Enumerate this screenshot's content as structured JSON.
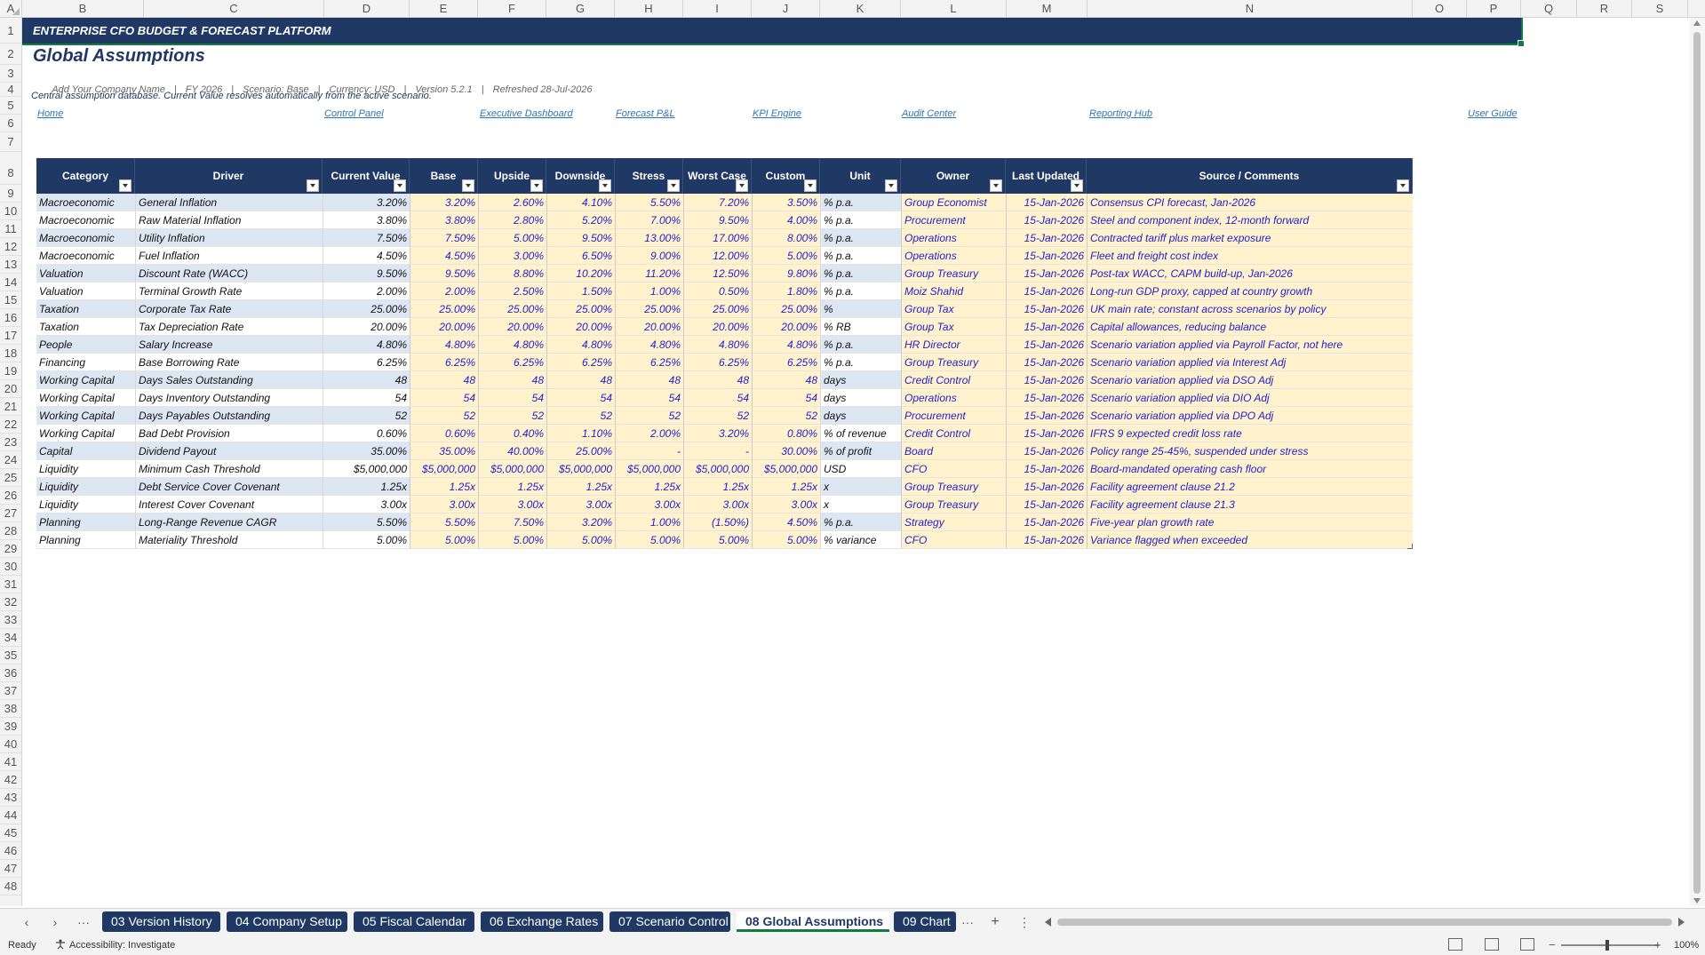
{
  "columns": [
    "A",
    "B",
    "C",
    "D",
    "E",
    "F",
    "G",
    "H",
    "I",
    "J",
    "K",
    "L",
    "M",
    "N",
    "O",
    "P",
    "Q",
    "R",
    "S"
  ],
  "rows": [
    "1",
    "2",
    "3",
    "4",
    "5",
    "6",
    "7",
    "8",
    "9",
    "10",
    "11",
    "12",
    "13",
    "14",
    "15",
    "16",
    "17",
    "18",
    "19",
    "20",
    "21",
    "22",
    "23",
    "24",
    "25",
    "26",
    "27",
    "28",
    "29",
    "30",
    "31",
    "32",
    "33",
    "34",
    "35",
    "36",
    "37",
    "38",
    "39",
    "40",
    "41",
    "42",
    "43",
    "44",
    "45",
    "46",
    "47",
    "48"
  ],
  "banner": "ENTERPRISE CFO BUDGET & FORECAST PLATFORM",
  "page_title": "Global Assumptions",
  "meta": {
    "company": "Add Your Company Name",
    "fy": "FY 2026",
    "scenario": "Scenario: Base",
    "currency": "Currency: USD",
    "version": "Version 5.2.1",
    "refreshed": "Refreshed 28-Jul-2026",
    "sep": "|"
  },
  "note": "Central assumption database. Current Value resolves automatically from the active scenario.",
  "nav_links": [
    "Home",
    "Control Panel",
    "Executive Dashboard",
    "Forecast P&L",
    "KPI Engine",
    "Audit Center",
    "Reporting Hub",
    "User Guide"
  ],
  "headers": [
    "Category",
    "Driver",
    "Current Value",
    "Base",
    "Upside",
    "Downside",
    "Stress",
    "Worst Case",
    "Custom",
    "Unit",
    "Owner",
    "Last Updated",
    "Source / Comments"
  ],
  "table_rows": [
    [
      "Macroeconomic",
      "General Inflation",
      "3.20%",
      "3.20%",
      "2.60%",
      "4.10%",
      "5.50%",
      "7.20%",
      "3.50%",
      "% p.a.",
      "Group Economist",
      "15-Jan-2026",
      "Consensus CPI forecast, Jan-2026"
    ],
    [
      "Macroeconomic",
      "Raw Material Inflation",
      "3.80%",
      "3.80%",
      "2.80%",
      "5.20%",
      "7.00%",
      "9.50%",
      "4.00%",
      "% p.a.",
      "Procurement",
      "15-Jan-2026",
      "Steel and component index, 12-month forward"
    ],
    [
      "Macroeconomic",
      "Utility Inflation",
      "7.50%",
      "7.50%",
      "5.00%",
      "9.50%",
      "13.00%",
      "17.00%",
      "8.00%",
      "% p.a.",
      "Operations",
      "15-Jan-2026",
      "Contracted tariff plus market exposure"
    ],
    [
      "Macroeconomic",
      "Fuel Inflation",
      "4.50%",
      "4.50%",
      "3.00%",
      "6.50%",
      "9.00%",
      "12.00%",
      "5.00%",
      "% p.a.",
      "Operations",
      "15-Jan-2026",
      "Fleet and freight cost index"
    ],
    [
      "Valuation",
      "Discount Rate (WACC)",
      "9.50%",
      "9.50%",
      "8.80%",
      "10.20%",
      "11.20%",
      "12.50%",
      "9.80%",
      "% p.a.",
      "Group Treasury",
      "15-Jan-2026",
      "Post-tax WACC, CAPM build-up, Jan-2026"
    ],
    [
      "Valuation",
      "Terminal Growth Rate",
      "2.00%",
      "2.00%",
      "2.50%",
      "1.50%",
      "1.00%",
      "0.50%",
      "1.80%",
      "% p.a.",
      "Moiz Shahid",
      "15-Jan-2026",
      "Long-run GDP proxy, capped at country growth"
    ],
    [
      "Taxation",
      "Corporate Tax Rate",
      "25.00%",
      "25.00%",
      "25.00%",
      "25.00%",
      "25.00%",
      "25.00%",
      "25.00%",
      "%",
      "Group Tax",
      "15-Jan-2026",
      "UK main rate; constant across scenarios by policy"
    ],
    [
      "Taxation",
      "Tax Depreciation Rate",
      "20.00%",
      "20.00%",
      "20.00%",
      "20.00%",
      "20.00%",
      "20.00%",
      "20.00%",
      "% RB",
      "Group Tax",
      "15-Jan-2026",
      "Capital allowances, reducing balance"
    ],
    [
      "People",
      "Salary Increase",
      "4.80%",
      "4.80%",
      "4.80%",
      "4.80%",
      "4.80%",
      "4.80%",
      "4.80%",
      "% p.a.",
      "HR Director",
      "15-Jan-2026",
      "Scenario variation applied via Payroll Factor, not here"
    ],
    [
      "Financing",
      "Base Borrowing Rate",
      "6.25%",
      "6.25%",
      "6.25%",
      "6.25%",
      "6.25%",
      "6.25%",
      "6.25%",
      "% p.a.",
      "Group Treasury",
      "15-Jan-2026",
      "Scenario variation applied via Interest Adj"
    ],
    [
      "Working Capital",
      "Days Sales Outstanding",
      "48",
      "48",
      "48",
      "48",
      "48",
      "48",
      "48",
      "days",
      "Credit Control",
      "15-Jan-2026",
      "Scenario variation applied via DSO Adj"
    ],
    [
      "Working Capital",
      "Days Inventory Outstanding",
      "54",
      "54",
      "54",
      "54",
      "54",
      "54",
      "54",
      "days",
      "Operations",
      "15-Jan-2026",
      "Scenario variation applied via DIO Adj"
    ],
    [
      "Working Capital",
      "Days Payables Outstanding",
      "52",
      "52",
      "52",
      "52",
      "52",
      "52",
      "52",
      "days",
      "Procurement",
      "15-Jan-2026",
      "Scenario variation applied via DPO Adj"
    ],
    [
      "Working Capital",
      "Bad Debt Provision",
      "0.60%",
      "0.60%",
      "0.40%",
      "1.10%",
      "2.00%",
      "3.20%",
      "0.80%",
      "% of revenue",
      "Credit Control",
      "15-Jan-2026",
      "IFRS 9 expected credit loss rate"
    ],
    [
      "Capital",
      "Dividend Payout",
      "35.00%",
      "35.00%",
      "40.00%",
      "25.00%",
      "-",
      "-",
      "30.00%",
      "% of profit",
      "Board",
      "15-Jan-2026",
      "Policy range 25-45%, suspended under stress"
    ],
    [
      "Liquidity",
      "Minimum Cash Threshold",
      "$5,000,000",
      "$5,000,000",
      "$5,000,000",
      "$5,000,000",
      "$5,000,000",
      "$5,000,000",
      "$5,000,000",
      "USD",
      "CFO",
      "15-Jan-2026",
      "Board-mandated operating cash floor"
    ],
    [
      "Liquidity",
      "Debt Service Cover Covenant",
      "1.25x",
      "1.25x",
      "1.25x",
      "1.25x",
      "1.25x",
      "1.25x",
      "1.25x",
      "x",
      "Group Treasury",
      "15-Jan-2026",
      "Facility agreement clause 21.2"
    ],
    [
      "Liquidity",
      "Interest Cover Covenant",
      "3.00x",
      "3.00x",
      "3.00x",
      "3.00x",
      "3.00x",
      "3.00x",
      "3.00x",
      "x",
      "Group Treasury",
      "15-Jan-2026",
      "Facility agreement clause 21.3"
    ],
    [
      "Planning",
      "Long-Range Revenue CAGR",
      "5.50%",
      "5.50%",
      "7.50%",
      "3.20%",
      "1.00%",
      "(1.50%)",
      "4.50%",
      "% p.a.",
      "Strategy",
      "15-Jan-2026",
      "Five-year plan growth rate"
    ],
    [
      "Planning",
      "Materiality Threshold",
      "5.00%",
      "5.00%",
      "5.00%",
      "5.00%",
      "5.00%",
      "5.00%",
      "5.00%",
      "% variance",
      "CFO",
      "15-Jan-2026",
      "Variance flagged when exceeded"
    ]
  ],
  "sheet_tabs": [
    "03 Version History",
    "04 Company Setup",
    "05 Fiscal Calendar",
    "06 Exchange Rates",
    "07 Scenario Control",
    "08 Global Assumptions",
    "09 Chart"
  ],
  "active_tab": "08 Global Assumptions",
  "tabbar_glyphs": {
    "prev": "‹",
    "next": "›",
    "more": "···",
    "add": "+",
    "options": "⋮"
  },
  "status": {
    "ready": "Ready",
    "accessibility": "Accessibility: Investigate",
    "zoom": "100%",
    "zoom_minus": "−",
    "zoom_plus": "+"
  },
  "colors": {
    "header_navy": "#1f3864",
    "input_fill": "#fff2cc",
    "input_text": "#1f1fd0",
    "band_fill": "#dde7f3",
    "active_green": "#107c41"
  }
}
